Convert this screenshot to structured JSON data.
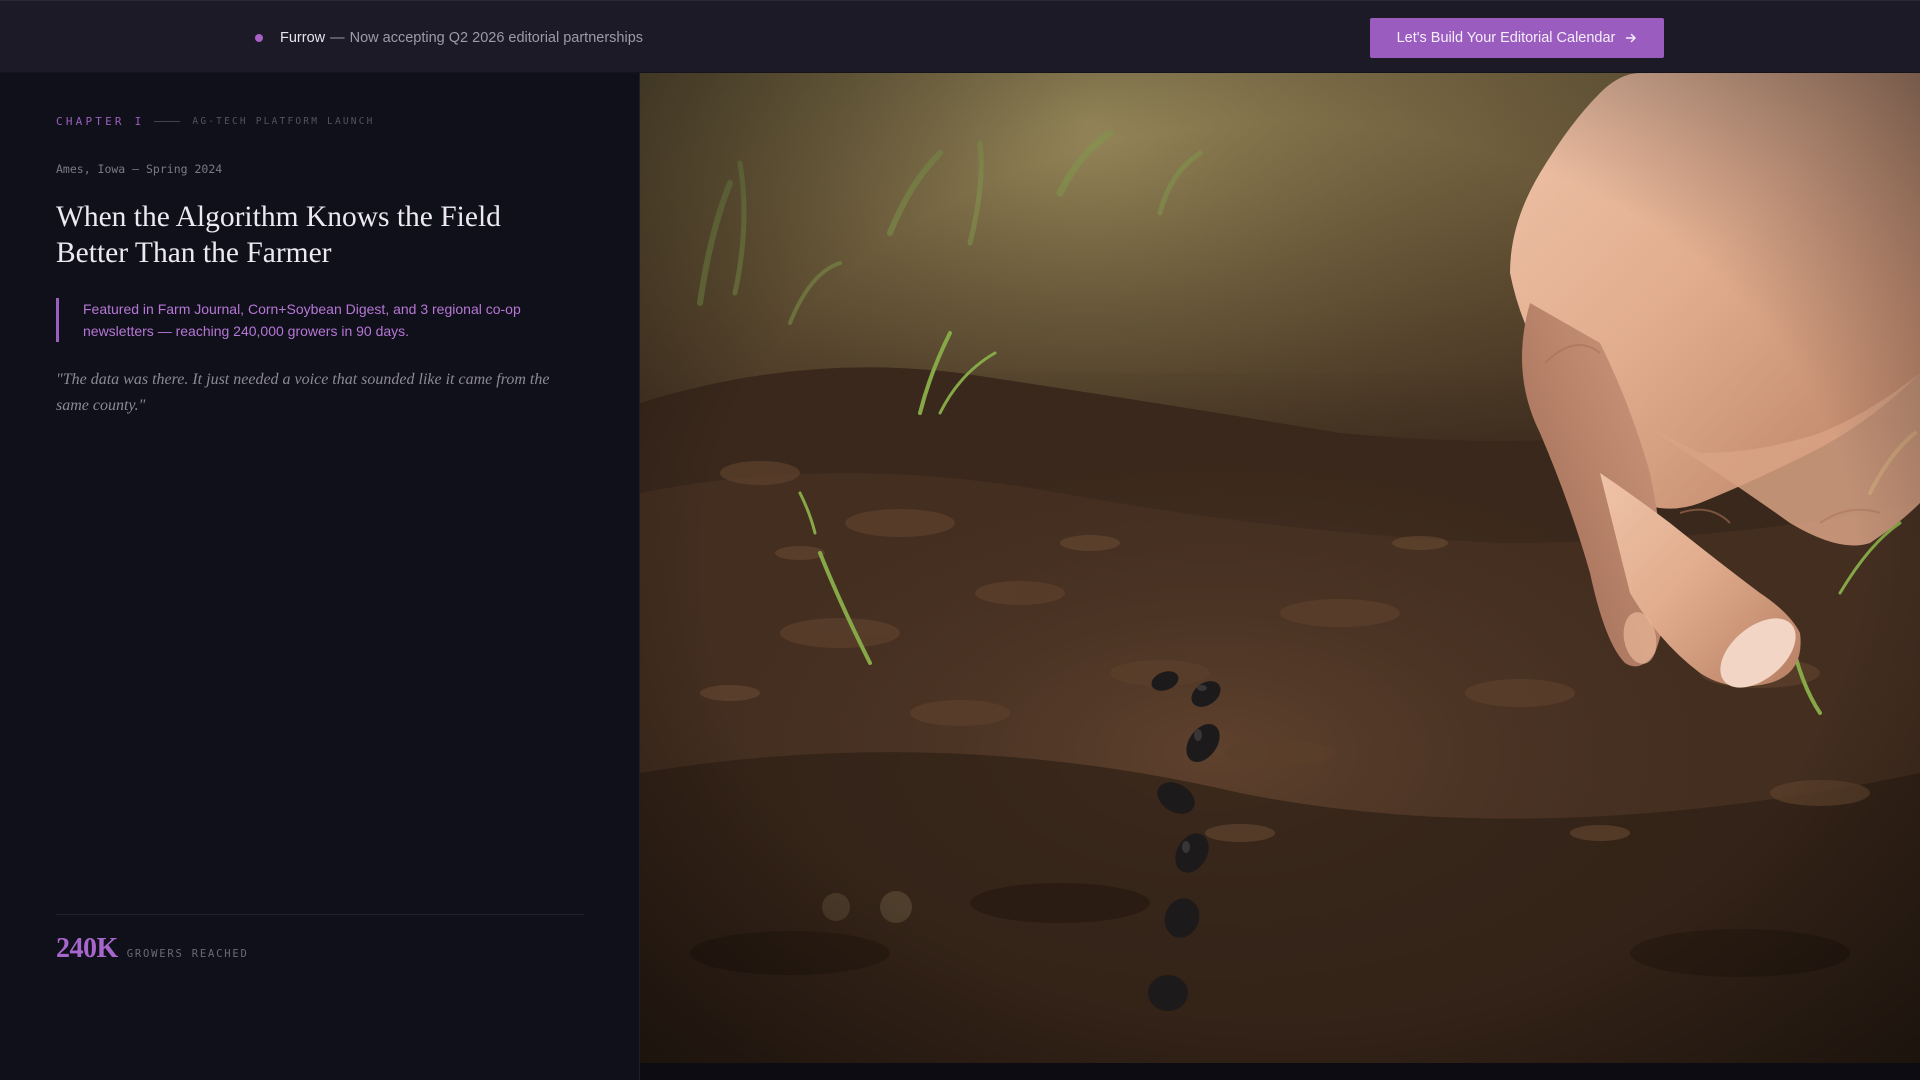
{
  "topbar": {
    "brand": "Furrow",
    "separator": "—",
    "announcement": "Now accepting Q2 2026 editorial partnerships",
    "cta_label": "Let's Build Your Editorial Calendar",
    "cta_icon": "arrow-right-icon",
    "accent_color": "#9a5cbf"
  },
  "story": {
    "chapter": "CHAPTER I",
    "category": "AG-TECH PLATFORM LAUNCH",
    "location": "Ames, Iowa — Spring 2024",
    "headline": "When the Algorithm Knows the Field Better Than the Farmer",
    "featured": "Featured in Farm Journal, Corn+Soybean Digest, and 3 regional co-op newsletters — reaching 240,000 growers in 90 days.",
    "quote": "\"The data was there. It just needed a voice that sounded like it came from the same county.\"",
    "stat_value": "240K",
    "stat_label": "GROWERS REACHED"
  },
  "hero": {
    "subject": "hand planting seeds in tilled soil"
  },
  "colors": {
    "background": "#10101a",
    "topbar": "#1c1a26",
    "accent": "#9b5fbe",
    "headline": "#ece9f1"
  }
}
